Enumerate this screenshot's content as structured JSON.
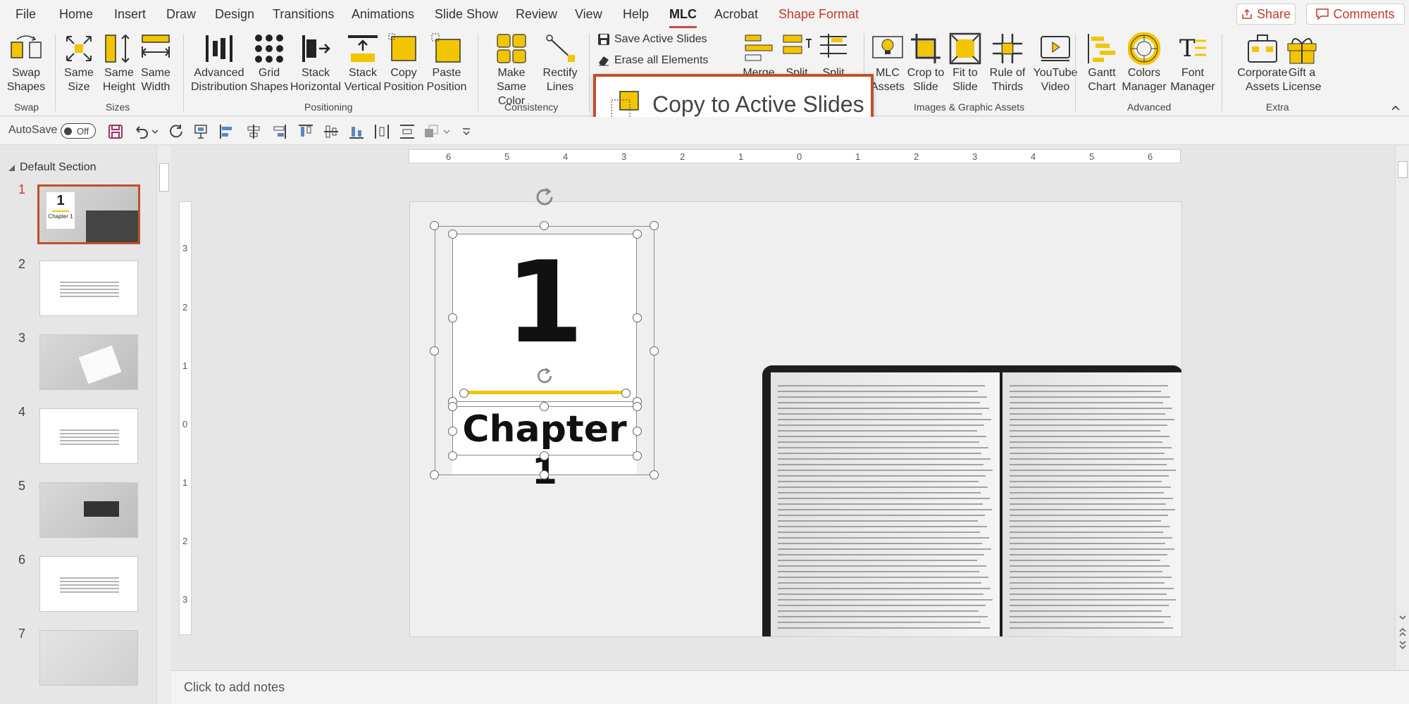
{
  "menu": {
    "tabs": [
      "File",
      "Home",
      "Insert",
      "Draw",
      "Design",
      "Transitions",
      "Animations",
      "Slide Show",
      "Review",
      "View",
      "Help",
      "MLC",
      "Acrobat",
      "Shape Format"
    ],
    "active_tab": "MLC",
    "share_label": "Share",
    "comments_label": "Comments"
  },
  "ribbon": {
    "swap": {
      "label": "Swap\nShapes",
      "group": "Swap"
    },
    "sizes": {
      "same_size": "Same\nSize",
      "same_height": "Same\nHeight",
      "same_width": "Same\nWidth",
      "group": "Sizes"
    },
    "positioning": {
      "advanced_distribution": "Advanced\nDistribution",
      "grid_shapes": "Grid\nShapes",
      "stack_horizontal": "Stack\nHorizontal",
      "stack_vertical": "Stack\nVertical",
      "copy_position": "Copy\nPosition",
      "paste_position": "Paste\nPosition",
      "group": "Positioning"
    },
    "consistency": {
      "make_same_color": "Make\nSame Color",
      "rectify_lines": "Rectify\nLines",
      "group": "Consistency"
    },
    "slides": {
      "save_active": "Save Active Slides",
      "erase_all": "Erase all Elements"
    },
    "partial": {
      "merge": "Merge",
      "split1": "Split",
      "split2": "Split"
    },
    "images": {
      "mlc_assets": "MLC\nAssets",
      "crop_to_slide": "Crop to\nSlide",
      "fit_to_slide": "Fit to\nSlide",
      "rule_of_thirds": "Rule of\nThirds",
      "youtube_video": "YouTube\nVideo",
      "group": "Images & Graphic Assets"
    },
    "advanced": {
      "gantt_chart": "Gantt\nChart",
      "colors_manager": "Colors\nManager",
      "font_manager": "Font\nManager",
      "group": "Advanced"
    },
    "extra": {
      "corporate_assets": "Corporate\nAssets",
      "gift_license": "Gift a\nLicense",
      "group": "Extra"
    },
    "tooltip": "Copy to Active Slides"
  },
  "qat": {
    "autosave_label": "AutoSave",
    "toggle_state": "Off"
  },
  "slides_panel": {
    "section": "Default Section",
    "slides": [
      {
        "num": "1",
        "kind": "title"
      },
      {
        "num": "2",
        "kind": "text"
      },
      {
        "num": "3",
        "kind": "photo"
      },
      {
        "num": "4",
        "kind": "text"
      },
      {
        "num": "5",
        "kind": "photo"
      },
      {
        "num": "6",
        "kind": "text"
      },
      {
        "num": "7",
        "kind": "photo"
      }
    ],
    "thumb_title_num": "1",
    "thumb_title_text": "Chapter 1"
  },
  "ruler": {
    "h": [
      "6",
      "5",
      "4",
      "3",
      "2",
      "1",
      "0",
      "1",
      "2",
      "3",
      "4",
      "5",
      "6"
    ],
    "v": [
      "3",
      "2",
      "1",
      "0",
      "1",
      "2",
      "3"
    ]
  },
  "slide": {
    "number": "1",
    "chapter": "Chapter 1"
  },
  "notes": {
    "placeholder": "Click to add notes"
  },
  "colors": {
    "accent": "#c0392b",
    "highlight": "#f2c500",
    "tooltip_border": "#c0502c"
  }
}
